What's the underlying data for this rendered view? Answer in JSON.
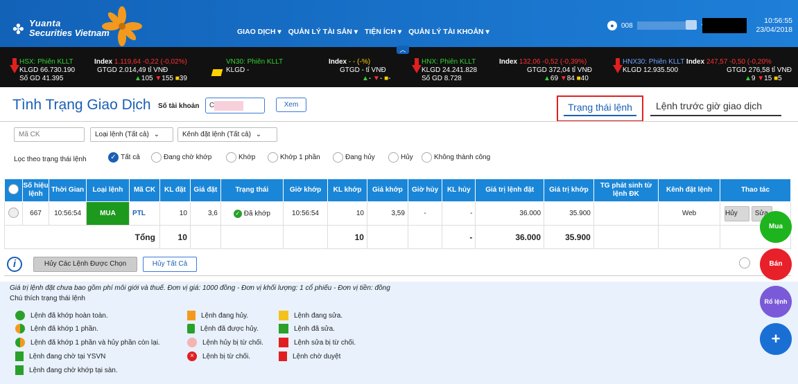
{
  "brand": {
    "line1": "Yuanta",
    "line2": "Securities Vietnam"
  },
  "nav": [
    "GIAO DỊCH",
    "QUẢN LÝ TÀI SẢN",
    "TIỆN ÍCH",
    "QUẢN LÝ TÀI KHOẢN"
  ],
  "account": {
    "prefix": "008",
    "suffix": "91"
  },
  "clock": {
    "time": "10:56:55",
    "date": "23/04/2018"
  },
  "ticker": [
    {
      "name": "HSX: Phiên KLLT",
      "index_label": "Index",
      "index": "1.119,64",
      "chg": "-0,22",
      "pct": "(-0,02%)",
      "klgd": "KLGD 66.730.190",
      "gtgd": "GTGD 2.014,49 tỉ VNĐ",
      "sogd": "Số GD 41.395",
      "up": "105",
      "down": "155",
      "eq": "39"
    },
    {
      "name": "VN30: Phiên KLLT",
      "index_label": "Index",
      "index": "-",
      "chg": "-",
      "pct": "(-%)",
      "klgd": "KLGD -",
      "gtgd": "GTGD - tỉ VNĐ",
      "up": "-",
      "down": "-",
      "eq": "-"
    },
    {
      "name": "HNX: Phiên KLLT",
      "index_label": "Index",
      "index": "132,06",
      "chg": "-0,52",
      "pct": "(-0,39%)",
      "klgd": "KLGD 24.241.828",
      "gtgd": "GTGD 372,04 tỉ VNĐ",
      "sogd": "Số GD 8.728",
      "up": "69",
      "down": "84",
      "eq": "40"
    },
    {
      "name": "HNX30: Phiên KLLT",
      "index_label": "Index",
      "index": "247,57",
      "chg": "-0,50",
      "pct": "(-0,20%",
      "klgd": "KLGD 12.935.500",
      "gtgd": "GTGD 276,58 tỉ VNĐ",
      "up": "9",
      "down": "15",
      "eq": "5"
    }
  ],
  "page": {
    "title": "Tình Trạng Giao Dịch",
    "account_label": "Số tài khoản",
    "account_value": "C",
    "view_btn": "Xem",
    "tab_active": "Trạng thái lệnh",
    "tab_other": "Lệnh trước giờ giao dịch"
  },
  "filters": {
    "symbol_ph": "Mã CK",
    "order_type": "Loại lệnh (Tất cả)",
    "channel": "Kênh đặt lệnh (Tất cả)",
    "status_label": "Lọc theo trạng thái lệnh",
    "statuses": [
      "Tất cả",
      "Đang chờ khớp",
      "Khớp",
      "Khớp 1 phần",
      "Đang hủy",
      "Hủy",
      "Không thành công"
    ]
  },
  "table": {
    "headers": [
      "Số hiệu lệnh",
      "Thời Gian",
      "Loại lệnh",
      "Mã CK",
      "KL đặt",
      "Giá đặt",
      "Trạng thái",
      "Giờ khớp",
      "KL khớp",
      "Giá khớp",
      "Giờ hủy",
      "KL hủy",
      "Giá trị lệnh đặt",
      "Giá trị khớp",
      "TG phát sinh từ lệnh ĐK",
      "Kênh đặt lệnh",
      "Thao tác"
    ],
    "row": {
      "id": "667",
      "time": "10:56:54",
      "type": "MUA",
      "symbol": "PTL",
      "qty": "10",
      "price": "3,6",
      "status": "Đã khớp",
      "match_time": "10:56:54",
      "match_qty": "10",
      "match_price": "3,59",
      "cancel_time": "-",
      "cancel_qty": "-",
      "order_value": "36.000",
      "match_value": "35.900",
      "channel": "Web",
      "cancel_btn": "Hủy",
      "edit_btn": "Sửa"
    },
    "total": {
      "label": "Tổng",
      "qty": "10",
      "match_qty": "10",
      "cancel_qty": "-",
      "order_value": "36.000",
      "match_value": "35.900"
    }
  },
  "actions": {
    "cancel_selected": "Hủy Các Lệnh Được Chọn",
    "cancel_all": "Hủy Tất Cả"
  },
  "legend": {
    "note": "Giá trị lệnh đặt chưa bao gồm phí môi giới và thuế. Đơn vị giá: 1000 đồng - Đơn vị khối lượng: 1 cổ phiếu - Đơn vị tiền: đồng",
    "title": "Chú thích trạng thái lệnh",
    "col1": [
      "Lệnh đã khớp hoàn toàn.",
      "Lệnh đã khớp 1 phần.",
      "Lệnh đã khớp 1 phần và hủy phần còn lại.",
      "Lệnh đang chờ tại YSVN",
      "Lệnh đang chờ khớp tại sàn."
    ],
    "col2": [
      "Lệnh đang hủy.",
      "Lệnh đã được hủy.",
      "Lệnh hủy bị từ chối.",
      "Lệnh bị từ chối."
    ],
    "col3": [
      "Lệnh đang sửa.",
      "Lệnh đã sửa.",
      "Lệnh sửa bị từ chối.",
      "Lệnh chờ duyệt"
    ]
  },
  "fab": {
    "buy": "Mua",
    "sell": "Bán",
    "basket": "Rổ lệnh",
    "plus": "+"
  }
}
